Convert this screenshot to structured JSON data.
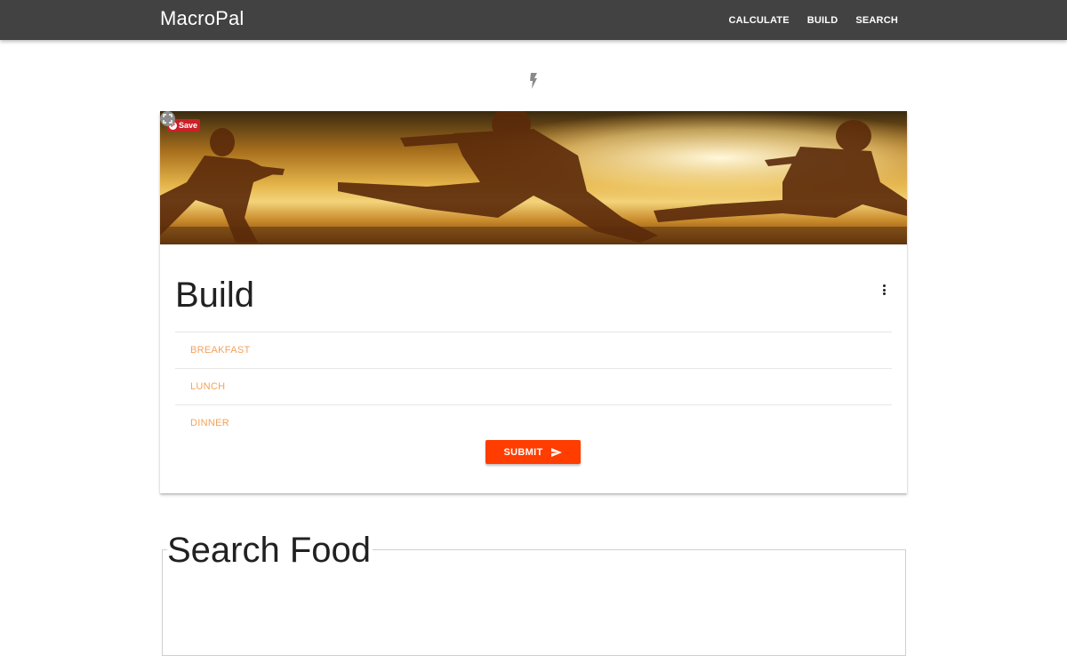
{
  "navbar": {
    "brand": "MacroPal",
    "links": [
      "CALCULATE",
      "BUILD",
      "SEARCH"
    ]
  },
  "card": {
    "save_label": "Save",
    "title": "Build",
    "meals": [
      "BREAKFAST",
      "LUNCH",
      "DINNER"
    ],
    "submit_label": "SUBMIT"
  },
  "search": {
    "title": "Search Food"
  },
  "colors": {
    "navbar": "#424242",
    "accent": "#ff3d00",
    "meal_text": "#f4a259",
    "pinterest": "#cb2027"
  },
  "icons": [
    "bolt-icon",
    "pinterest-icon",
    "expand-icon",
    "more-vert-icon",
    "send-icon"
  ]
}
